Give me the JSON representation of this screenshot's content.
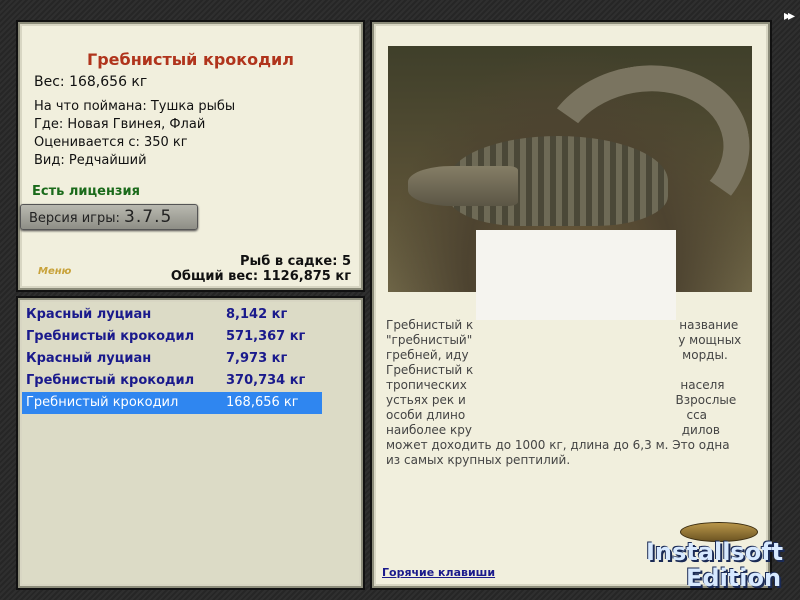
{
  "info": {
    "title": "Гребнистый крокодил",
    "weight": "Вес: 168,656 кг",
    "facts": [
      "На что поймана: Тушка рыбы",
      "Где: Новая Гвинея, Флай",
      "Оценивается с: 350 кг",
      "Вид: Редчайший"
    ],
    "license": "Есть лицензия",
    "version_label": "Версия игры:",
    "version_value": "3.7.5",
    "menu": "Меню",
    "fish_in_cage": "Рыб в садке: 5",
    "total_weight": "Общий вес: 1126,875 кг"
  },
  "catches": [
    {
      "name": "Красный луциан",
      "weight": "8,142 кг"
    },
    {
      "name": "Гребнистый крокодил",
      "weight": "571,367 кг"
    },
    {
      "name": "Красный луциан",
      "weight": "7,973 кг"
    },
    {
      "name": "Гребнистый крокодил",
      "weight": "370,734 кг"
    },
    {
      "name": "Гребнистый крокодил",
      "weight": "168,656 кг"
    }
  ],
  "selected_index": 4,
  "detail": {
    "desc_lines": [
      "Гребнистый к                                                      название",
      "\"гребнистый\"                                                      у мощных",
      "гребней, иду                                                        морды.",
      "Гребнистый к",
      "тропических                                                        населя",
      "устьях рек и                                                       Взрослые",
      "особи длино                                                          сса",
      "наиболее кру                                                       дилов",
      "может доходить до 1000 кг, длина до 6,3 м. Это одна",
      "из самых крупных рептилий."
    ],
    "hotkeys": "Горячие клавиши"
  },
  "nav": {
    "forward": "▸▸"
  },
  "logo": {
    "line1": "Installsoft",
    "line2": "Edition"
  },
  "colors": {
    "title": "#b0341c",
    "license": "#1a6a1a",
    "list_text": "#1a1a8c",
    "selection": "#2f86f0"
  }
}
